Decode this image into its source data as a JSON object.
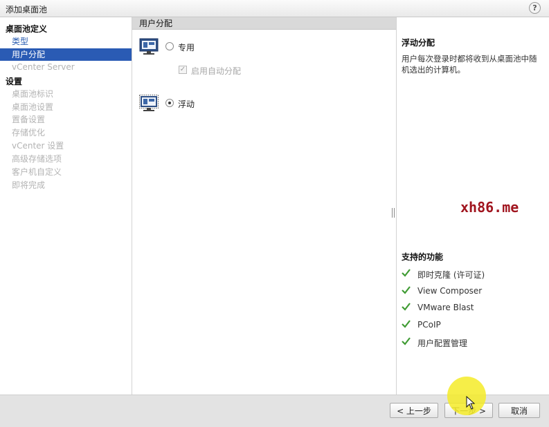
{
  "window": {
    "title": "添加桌面池",
    "help_label": "?"
  },
  "nav": {
    "sections": [
      {
        "header": "桌面池定义",
        "items": [
          {
            "label": "类型",
            "state": "link"
          },
          {
            "label": "用户分配",
            "state": "selected"
          },
          {
            "label": "vCenter Server",
            "state": "disabled"
          }
        ]
      },
      {
        "header": "设置",
        "items": [
          {
            "label": "桌面池标识",
            "state": "disabled"
          },
          {
            "label": "桌面池设置",
            "state": "disabled"
          },
          {
            "label": "置备设置",
            "state": "disabled"
          },
          {
            "label": "存储优化",
            "state": "disabled"
          },
          {
            "label": "vCenter 设置",
            "state": "disabled"
          },
          {
            "label": "高级存储选项",
            "state": "disabled"
          },
          {
            "label": "客户机自定义",
            "state": "disabled"
          },
          {
            "label": "即将完成",
            "state": "disabled"
          }
        ]
      }
    ]
  },
  "center": {
    "header": "用户分配",
    "options": [
      {
        "label": "专用",
        "checked": false
      },
      {
        "label": "浮动",
        "checked": true
      }
    ],
    "auto_assign_label": "启用自动分配",
    "auto_assign_checked": true
  },
  "info": {
    "title": "浮动分配",
    "description": "用户每次登录时都将收到从桌面池中随机选出的计算机。",
    "features_title": "支持的功能",
    "features": [
      "即时克隆 (许可证)",
      "View Composer",
      "VMware Blast",
      "PCoIP",
      "用户配置管理"
    ]
  },
  "watermark": "xh86.me",
  "buttons": {
    "back": "< 上一步",
    "next": "下一步 >",
    "cancel": "取消"
  },
  "colors": {
    "selection": "#2a5bb4",
    "check": "#3f9b33",
    "watermark": "#a0141e"
  },
  "icons": {
    "help": "help-icon",
    "desktop": "desktop-pool-icon",
    "check": "check-icon"
  }
}
